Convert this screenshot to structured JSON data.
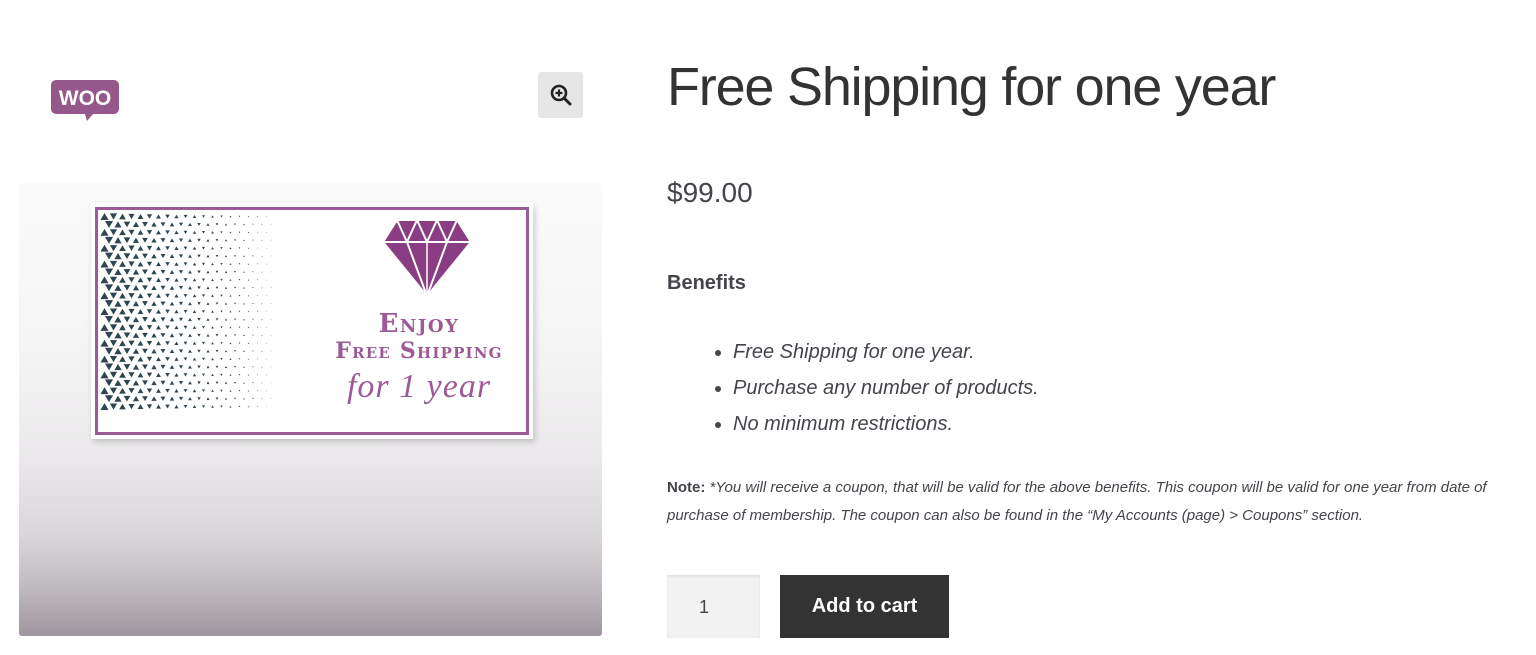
{
  "brand": {
    "logo_text": "WOO",
    "logo_color": "#96588a",
    "zoom_icon": "zoom-in-icon"
  },
  "product_image": {
    "line1": "Enjoy",
    "line2": "Free Shipping",
    "line3": "for 1 year",
    "accent_color": "#9c5a96",
    "pattern_color": "#2f4552"
  },
  "product": {
    "title": "Free Shipping for one year",
    "price": "$99.00"
  },
  "description": {
    "heading": "Benefits",
    "benefits": [
      "Free Shipping for one year.",
      "Purchase any number of products.",
      "No minimum restrictions."
    ],
    "note_label": "Note:",
    "note_text": "*You will receive a coupon, that will be valid for the above benefits. This coupon will be valid for one year from date of purchase of membership. The coupon can also be found in the “My Accounts (page) > Coupons” section."
  },
  "cart": {
    "quantity": "1",
    "button_label": "Add to cart",
    "button_color": "#333333"
  }
}
